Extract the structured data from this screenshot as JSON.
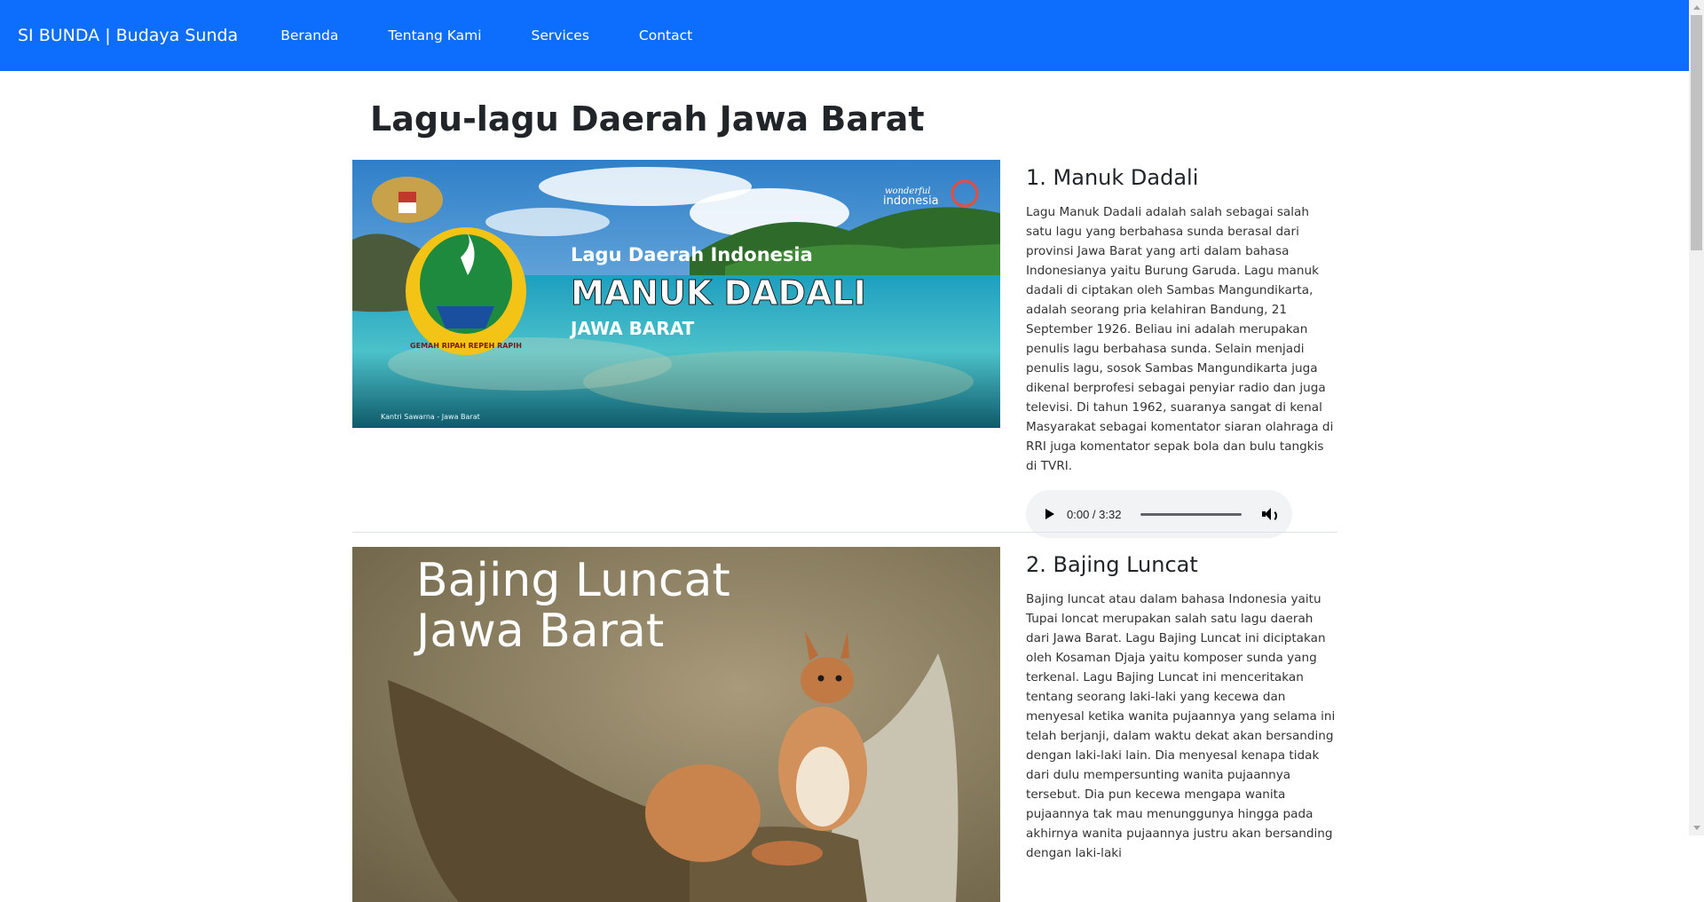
{
  "navbar": {
    "brand": "SI BUNDA | Budaya Sunda",
    "links": [
      "Beranda",
      "Tentang Kami",
      "Services",
      "Contact"
    ],
    "color": "#0d6efd"
  },
  "page": {
    "title": "Lagu-lagu Daerah Jawa Barat"
  },
  "songs": [
    {
      "heading": "1. Manuk Dadali",
      "description": "Lagu Manuk Dadali adalah salah sebagai salah satu lagu yang berbahasa sunda berasal dari provinsi Jawa Barat yang arti dalam bahasa Indonesianya yaitu Burung Garuda. Lagu manuk dadali di ciptakan oleh Sambas Mangundikarta, adalah seorang pria kelahiran Bandung, 21 September 1926. Beliau ini adalah merupakan penulis lagu berbahasa sunda. Selain menjadi penulis lagu, sosok Sambas Mangundikarta juga dikenal berprofesi sebagai penyiar radio dan juga televisi. Di tahun 1962, suaranya sangat di kenal Masyarakat sebagai komentator siaran olahraga di RRI juga komentator sepak bola dan bulu tangkis di TVRI.",
      "audio_time": "0:00 / 3:32",
      "image": {
        "line1": "Lagu Daerah Indonesia",
        "line2": "MANUK DADALI",
        "line3": "JAWA BARAT",
        "badge_top": "wonderful",
        "badge_bottom": "indonesia",
        "seal_text": "GEMAH RIPAH REPEH RAPIH",
        "credit": "Kantri Sawarna - Jawa Barat"
      }
    },
    {
      "heading": "2. Bajing Luncat",
      "description": "Bajing luncat atau dalam bahasa Indonesia yaitu Tupai loncat merupakan salah satu lagu daerah dari Jawa Barat. Lagu Bajing Luncat ini diciptakan oleh Kosaman Djaja yaitu komposer sunda yang terkenal. Lagu Bajing Luncat ini menceritakan tentang seorang laki-laki yang kecewa dan menyesal ketika wanita pujaannya yang selama ini telah berjanji, dalam waktu dekat akan bersanding dengan laki-laki lain. Dia menyesal kenapa tidak dari dulu mempersunting wanita pujaannya tersebut. Dia pun kecewa mengapa wanita pujaannya tak mau menunggunya hingga pada akhirnya wanita pujaannya justru akan bersanding dengan laki-laki",
      "image": {
        "line1": "Bajing Luncat",
        "line2": "Jawa Barat"
      }
    }
  ]
}
